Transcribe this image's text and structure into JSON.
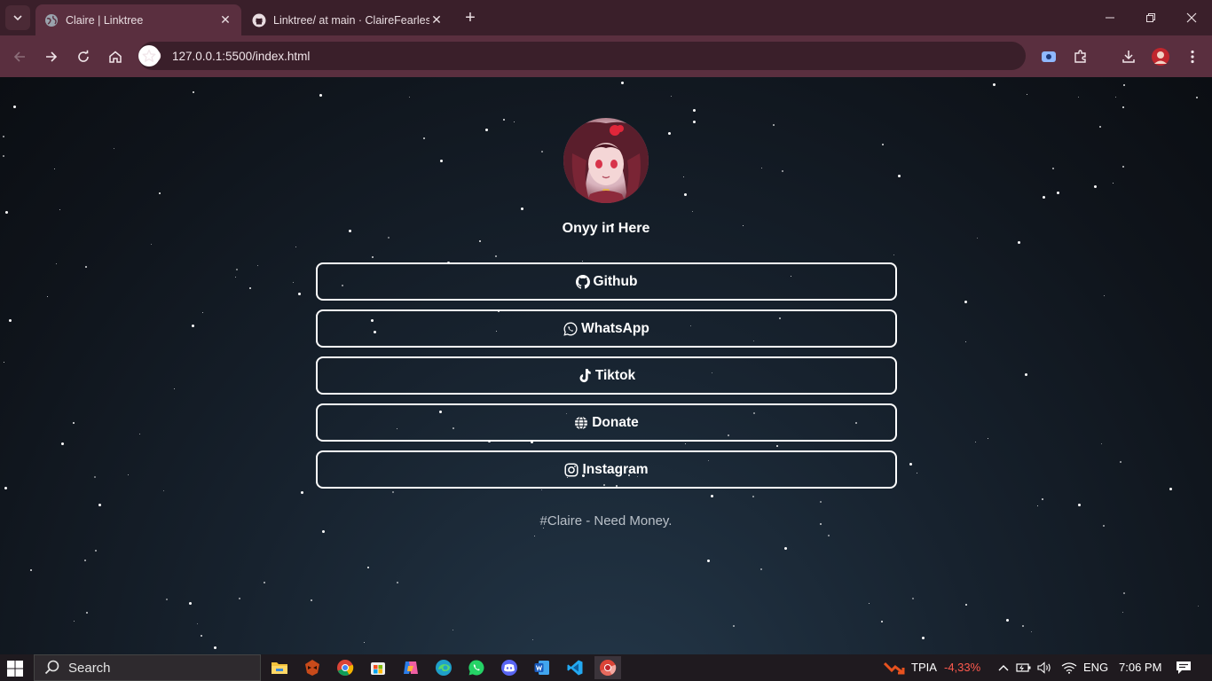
{
  "browser": {
    "tabs": [
      {
        "title": "Claire | Linktree",
        "active": true
      },
      {
        "title": "Linktree/ at main · ClaireFearless",
        "active": false
      }
    ],
    "address": "127.0.0.1:5500/index.html"
  },
  "page": {
    "profile_name": "Onyy in Here",
    "links": [
      {
        "label": "Github",
        "icon": "github-icon"
      },
      {
        "label": "WhatsApp",
        "icon": "whatsapp-icon"
      },
      {
        "label": "Tiktok",
        "icon": "tiktok-icon"
      },
      {
        "label": "Donate",
        "icon": "globe-icon"
      },
      {
        "label": "Instagram",
        "icon": "instagram-icon"
      }
    ],
    "footer": "#Claire - Need Money."
  },
  "taskbar": {
    "search_placeholder": "Search",
    "stock_ticker": "TPIA",
    "stock_change": "-4,33%",
    "language": "ENG",
    "time": "7:06 PM"
  },
  "colors": {
    "chrome_frame": "#3a1f2a",
    "chrome_toolbar": "#5a2f3f",
    "page_bg": "#0f141b",
    "stock_down": "#ff5a4e"
  }
}
